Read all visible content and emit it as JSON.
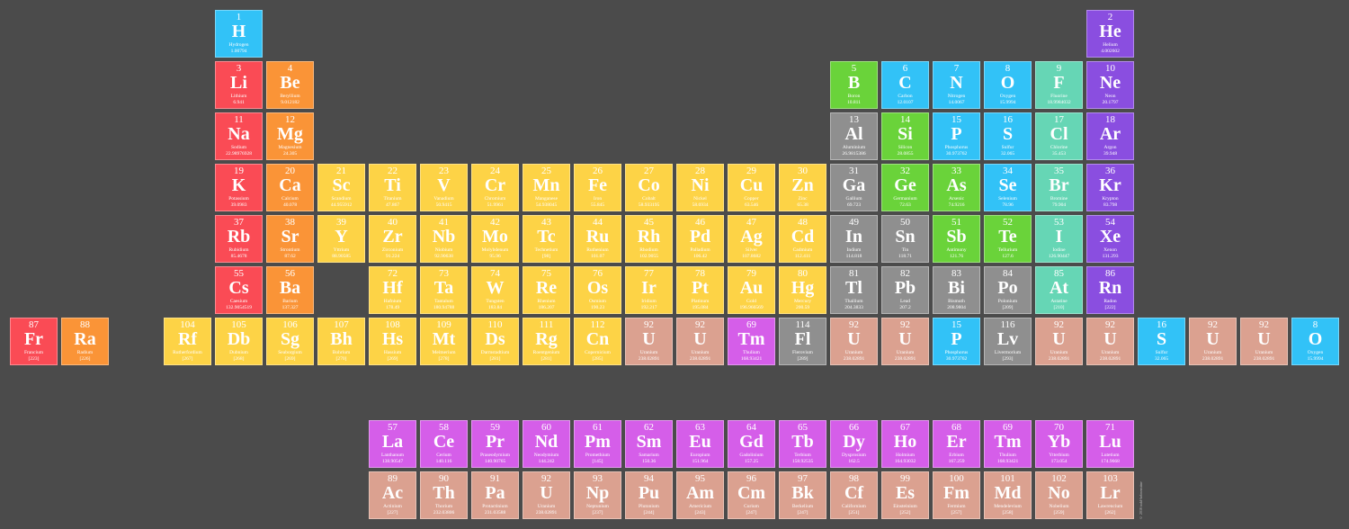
{
  "colors": {
    "alkali": "#fa4b55",
    "alkaline": "#fa9437",
    "transition": "#fdd346",
    "post": "#8f8f8f",
    "metalloid": "#6ad33a",
    "nonmetal": "#32c2f7",
    "halogen": "#66d6b5",
    "noble": "#8a4ee0",
    "lanthanide": "#d55ee9",
    "actinide": "#dba190"
  },
  "credit": "© 2016 todd-helmenstine",
  "elements": [
    {
      "n": "1",
      "s": "H",
      "name": "Hydrogen",
      "w": "1.00794",
      "c": "nonmetal",
      "col": 4,
      "row": 0
    },
    {
      "n": "2",
      "s": "He",
      "name": "Helium",
      "w": "4.002602",
      "c": "noble",
      "col": 21,
      "row": 0
    },
    {
      "n": "3",
      "s": "Li",
      "name": "Lithium",
      "w": "6.941",
      "c": "alkali",
      "col": 4,
      "row": 1
    },
    {
      "n": "4",
      "s": "Be",
      "name": "Beryllium",
      "w": "9.012182",
      "c": "alkaline",
      "col": 5,
      "row": 1
    },
    {
      "n": "5",
      "s": "B",
      "name": "Boron",
      "w": "10.811",
      "c": "metalloid",
      "col": 16,
      "row": 1
    },
    {
      "n": "6",
      "s": "C",
      "name": "Carbon",
      "w": "12.0107",
      "c": "nonmetal",
      "col": 17,
      "row": 1
    },
    {
      "n": "7",
      "s": "N",
      "name": "Nitrogen",
      "w": "14.0067",
      "c": "nonmetal",
      "col": 18,
      "row": 1
    },
    {
      "n": "8",
      "s": "O",
      "name": "Oxygen",
      "w": "15.9994",
      "c": "nonmetal",
      "col": 19,
      "row": 1
    },
    {
      "n": "9",
      "s": "F",
      "name": "Fluorine",
      "w": "18.9984032",
      "c": "halogen",
      "col": 20,
      "row": 1
    },
    {
      "n": "10",
      "s": "Ne",
      "name": "Neon",
      "w": "20.1797",
      "c": "noble",
      "col": 21,
      "row": 1
    },
    {
      "n": "11",
      "s": "Na",
      "name": "Sodium",
      "w": "22.98976928",
      "c": "alkali",
      "col": 4,
      "row": 2
    },
    {
      "n": "12",
      "s": "Mg",
      "name": "Magnesium",
      "w": "24.305",
      "c": "alkaline",
      "col": 5,
      "row": 2
    },
    {
      "n": "13",
      "s": "Al",
      "name": "Aluminium",
      "w": "26.9815386",
      "c": "post",
      "col": 16,
      "row": 2
    },
    {
      "n": "14",
      "s": "Si",
      "name": "Silicon",
      "w": "28.0855",
      "c": "metalloid",
      "col": 17,
      "row": 2
    },
    {
      "n": "15",
      "s": "P",
      "name": "Phosphorus",
      "w": "30.973762",
      "c": "nonmetal",
      "col": 18,
      "row": 2
    },
    {
      "n": "16",
      "s": "S",
      "name": "Sulfur",
      "w": "32.065",
      "c": "nonmetal",
      "col": 19,
      "row": 2
    },
    {
      "n": "17",
      "s": "Cl",
      "name": "Chlorine",
      "w": "35.453",
      "c": "halogen",
      "col": 20,
      "row": 2
    },
    {
      "n": "18",
      "s": "Ar",
      "name": "Argon",
      "w": "39.948",
      "c": "noble",
      "col": 21,
      "row": 2
    },
    {
      "n": "19",
      "s": "K",
      "name": "Potassium",
      "w": "39.0983",
      "c": "alkali",
      "col": 4,
      "row": 3
    },
    {
      "n": "20",
      "s": "Ca",
      "name": "Calcium",
      "w": "40.078",
      "c": "alkaline",
      "col": 5,
      "row": 3
    },
    {
      "n": "21",
      "s": "Sc",
      "name": "Scandium",
      "w": "44.955912",
      "c": "transition",
      "col": 6,
      "row": 3
    },
    {
      "n": "22",
      "s": "Ti",
      "name": "Titanium",
      "w": "47.867",
      "c": "transition",
      "col": 7,
      "row": 3
    },
    {
      "n": "23",
      "s": "V",
      "name": "Vanadium",
      "w": "50.9415",
      "c": "transition",
      "col": 8,
      "row": 3
    },
    {
      "n": "24",
      "s": "Cr",
      "name": "Chromium",
      "w": "51.9961",
      "c": "transition",
      "col": 9,
      "row": 3
    },
    {
      "n": "25",
      "s": "Mn",
      "name": "Manganese",
      "w": "54.938045",
      "c": "transition",
      "col": 10,
      "row": 3
    },
    {
      "n": "26",
      "s": "Fe",
      "name": "Iron",
      "w": "55.845",
      "c": "transition",
      "col": 11,
      "row": 3
    },
    {
      "n": "27",
      "s": "Co",
      "name": "Cobalt",
      "w": "58.933195",
      "c": "transition",
      "col": 12,
      "row": 3
    },
    {
      "n": "28",
      "s": "Ni",
      "name": "Nickel",
      "w": "58.6934",
      "c": "transition",
      "col": 13,
      "row": 3
    },
    {
      "n": "29",
      "s": "Cu",
      "name": "Copper",
      "w": "63.546",
      "c": "transition",
      "col": 14,
      "row": 3
    },
    {
      "n": "30",
      "s": "Zn",
      "name": "Zinc",
      "w": "65.38",
      "c": "transition",
      "col": 15,
      "row": 3
    },
    {
      "n": "31",
      "s": "Ga",
      "name": "Gallium",
      "w": "69.723",
      "c": "post",
      "col": 16,
      "row": 3
    },
    {
      "n": "32",
      "s": "Ge",
      "name": "Germanium",
      "w": "72.63",
      "c": "metalloid",
      "col": 17,
      "row": 3
    },
    {
      "n": "33",
      "s": "As",
      "name": "Arsenic",
      "w": "74.9216",
      "c": "metalloid",
      "col": 18,
      "row": 3
    },
    {
      "n": "34",
      "s": "Se",
      "name": "Selenium",
      "w": "78.96",
      "c": "nonmetal",
      "col": 19,
      "row": 3
    },
    {
      "n": "35",
      "s": "Br",
      "name": "Bromine",
      "w": "79.904",
      "c": "halogen",
      "col": 20,
      "row": 3
    },
    {
      "n": "36",
      "s": "Kr",
      "name": "Krypton",
      "w": "83.798",
      "c": "noble",
      "col": 21,
      "row": 3
    },
    {
      "n": "37",
      "s": "Rb",
      "name": "Rubidium",
      "w": "85.4678",
      "c": "alkali",
      "col": 4,
      "row": 4
    },
    {
      "n": "38",
      "s": "Sr",
      "name": "Strontium",
      "w": "87.62",
      "c": "alkaline",
      "col": 5,
      "row": 4
    },
    {
      "n": "39",
      "s": "Y",
      "name": "Yttrium",
      "w": "88.90585",
      "c": "transition",
      "col": 6,
      "row": 4
    },
    {
      "n": "40",
      "s": "Zr",
      "name": "Zirconium",
      "w": "91.224",
      "c": "transition",
      "col": 7,
      "row": 4
    },
    {
      "n": "41",
      "s": "Nb",
      "name": "Niobium",
      "w": "92.90638",
      "c": "transition",
      "col": 8,
      "row": 4
    },
    {
      "n": "42",
      "s": "Mo",
      "name": "Molybdenum",
      "w": "95.96",
      "c": "transition",
      "col": 9,
      "row": 4
    },
    {
      "n": "43",
      "s": "Tc",
      "name": "Technetium",
      "w": "[98]",
      "c": "transition",
      "col": 10,
      "row": 4
    },
    {
      "n": "44",
      "s": "Ru",
      "name": "Ruthenium",
      "w": "101.07",
      "c": "transition",
      "col": 11,
      "row": 4
    },
    {
      "n": "45",
      "s": "Rh",
      "name": "Rhodium",
      "w": "102.9055",
      "c": "transition",
      "col": 12,
      "row": 4
    },
    {
      "n": "46",
      "s": "Pd",
      "name": "Palladium",
      "w": "106.42",
      "c": "transition",
      "col": 13,
      "row": 4
    },
    {
      "n": "47",
      "s": "Ag",
      "name": "Silver",
      "w": "107.8682",
      "c": "transition",
      "col": 14,
      "row": 4
    },
    {
      "n": "48",
      "s": "Cd",
      "name": "Cadmium",
      "w": "112.411",
      "c": "transition",
      "col": 15,
      "row": 4
    },
    {
      "n": "49",
      "s": "In",
      "name": "Indium",
      "w": "114.818",
      "c": "post",
      "col": 16,
      "row": 4
    },
    {
      "n": "50",
      "s": "Sn",
      "name": "Tin",
      "w": "118.71",
      "c": "post",
      "col": 17,
      "row": 4
    },
    {
      "n": "51",
      "s": "Sb",
      "name": "Antimony",
      "w": "121.76",
      "c": "metalloid",
      "col": 18,
      "row": 4
    },
    {
      "n": "52",
      "s": "Te",
      "name": "Tellurium",
      "w": "127.6",
      "c": "metalloid",
      "col": 19,
      "row": 4
    },
    {
      "n": "53",
      "s": "I",
      "name": "Iodine",
      "w": "126.90447",
      "c": "halogen",
      "col": 20,
      "row": 4
    },
    {
      "n": "54",
      "s": "Xe",
      "name": "Xenon",
      "w": "131.293",
      "c": "noble",
      "col": 21,
      "row": 4
    },
    {
      "n": "55",
      "s": "Cs",
      "name": "Caesium",
      "w": "132.9054519",
      "c": "alkali",
      "col": 4,
      "row": 5
    },
    {
      "n": "56",
      "s": "Ba",
      "name": "Barium",
      "w": "137.327",
      "c": "alkaline",
      "col": 5,
      "row": 5
    },
    {
      "n": "72",
      "s": "Hf",
      "name": "Hafnium",
      "w": "178.49",
      "c": "transition",
      "col": 7,
      "row": 5
    },
    {
      "n": "73",
      "s": "Ta",
      "name": "Tantalum",
      "w": "180.94788",
      "c": "transition",
      "col": 8,
      "row": 5
    },
    {
      "n": "74",
      "s": "W",
      "name": "Tungsten",
      "w": "183.84",
      "c": "transition",
      "col": 9,
      "row": 5
    },
    {
      "n": "75",
      "s": "Re",
      "name": "Rhenium",
      "w": "186.207",
      "c": "transition",
      "col": 10,
      "row": 5
    },
    {
      "n": "76",
      "s": "Os",
      "name": "Osmium",
      "w": "190.23",
      "c": "transition",
      "col": 11,
      "row": 5
    },
    {
      "n": "77",
      "s": "Ir",
      "name": "Iridium",
      "w": "192.217",
      "c": "transition",
      "col": 12,
      "row": 5
    },
    {
      "n": "78",
      "s": "Pt",
      "name": "Platinum",
      "w": "195.084",
      "c": "transition",
      "col": 13,
      "row": 5
    },
    {
      "n": "79",
      "s": "Au",
      "name": "Gold",
      "w": "196.966569",
      "c": "transition",
      "col": 14,
      "row": 5
    },
    {
      "n": "80",
      "s": "Hg",
      "name": "Mercury",
      "w": "200.59",
      "c": "transition",
      "col": 15,
      "row": 5
    },
    {
      "n": "81",
      "s": "Tl",
      "name": "Thallium",
      "w": "204.3833",
      "c": "post",
      "col": 16,
      "row": 5
    },
    {
      "n": "82",
      "s": "Pb",
      "name": "Lead",
      "w": "207.2",
      "c": "post",
      "col": 17,
      "row": 5
    },
    {
      "n": "83",
      "s": "Bi",
      "name": "Bismuth",
      "w": "208.9804",
      "c": "post",
      "col": 18,
      "row": 5
    },
    {
      "n": "84",
      "s": "Po",
      "name": "Polonium",
      "w": "[209]",
      "c": "post",
      "col": 19,
      "row": 5
    },
    {
      "n": "85",
      "s": "At",
      "name": "Astatine",
      "w": "[210]",
      "c": "halogen",
      "col": 20,
      "row": 5
    },
    {
      "n": "86",
      "s": "Rn",
      "name": "Radon",
      "w": "[222]",
      "c": "noble",
      "col": 21,
      "row": 5
    },
    {
      "n": "87",
      "s": "Fr",
      "name": "Francium",
      "w": "[223]",
      "c": "alkali",
      "col": 0,
      "row": 6
    },
    {
      "n": "88",
      "s": "Ra",
      "name": "Radium",
      "w": "[226]",
      "c": "alkaline",
      "col": 1,
      "row": 6
    },
    {
      "n": "104",
      "s": "Rf",
      "name": "Rutherfordium",
      "w": "[267]",
      "c": "transition",
      "col": 3,
      "row": 6
    },
    {
      "n": "105",
      "s": "Db",
      "name": "Dubnium",
      "w": "[268]",
      "c": "transition",
      "col": 4,
      "row": 6
    },
    {
      "n": "106",
      "s": "Sg",
      "name": "Seaborgium",
      "w": "[269]",
      "c": "transition",
      "col": 5,
      "row": 6
    },
    {
      "n": "107",
      "s": "Bh",
      "name": "Bohrium",
      "w": "[270]",
      "c": "transition",
      "col": 6,
      "row": 6
    },
    {
      "n": "108",
      "s": "Hs",
      "name": "Hassium",
      "w": "[269]",
      "c": "transition",
      "col": 7,
      "row": 6
    },
    {
      "n": "109",
      "s": "Mt",
      "name": "Meitnerium",
      "w": "[278]",
      "c": "transition",
      "col": 8,
      "row": 6
    },
    {
      "n": "110",
      "s": "Ds",
      "name": "Darmstadtium",
      "w": "[281]",
      "c": "transition",
      "col": 9,
      "row": 6
    },
    {
      "n": "111",
      "s": "Rg",
      "name": "Roentgenium",
      "w": "[281]",
      "c": "transition",
      "col": 10,
      "row": 6
    },
    {
      "n": "112",
      "s": "Cn",
      "name": "Copernicium",
      "w": "[285]",
      "c": "transition",
      "col": 11,
      "row": 6
    },
    {
      "n": "92",
      "s": "U",
      "name": "Uranium",
      "w": "238.02891",
      "c": "actinide",
      "col": 12,
      "row": 6
    },
    {
      "n": "92",
      "s": "U",
      "name": "Uranium",
      "w": "238.02891",
      "c": "actinide",
      "col": 13,
      "row": 6
    },
    {
      "n": "69",
      "s": "Tm",
      "name": "Thulium",
      "w": "168.93421",
      "c": "lanthanide",
      "col": 14,
      "row": 6
    },
    {
      "n": "114",
      "s": "Fl",
      "name": "Flerovium",
      "w": "[289]",
      "c": "post",
      "col": 15,
      "row": 6
    },
    {
      "n": "92",
      "s": "U",
      "name": "Uranium",
      "w": "238.02891",
      "c": "actinide",
      "col": 16,
      "row": 6
    },
    {
      "n": "92",
      "s": "U",
      "name": "Uranium",
      "w": "238.02891",
      "c": "actinide",
      "col": 17,
      "row": 6
    },
    {
      "n": "15",
      "s": "P",
      "name": "Phosphorus",
      "w": "30.973762",
      "c": "nonmetal",
      "col": 18,
      "row": 6
    },
    {
      "n": "116",
      "s": "Lv",
      "name": "Livermorium",
      "w": "[293]",
      "c": "post",
      "col": 19,
      "row": 6
    },
    {
      "n": "92",
      "s": "U",
      "name": "Uranium",
      "w": "238.02891",
      "c": "actinide",
      "col": 20,
      "row": 6
    },
    {
      "n": "92",
      "s": "U",
      "name": "Uranium",
      "w": "238.02891",
      "c": "actinide",
      "col": 21,
      "row": 6
    },
    {
      "n": "16",
      "s": "S",
      "name": "Sulfur",
      "w": "32.065",
      "c": "nonmetal",
      "col": 22,
      "row": 6
    },
    {
      "n": "92",
      "s": "U",
      "name": "Uranium",
      "w": "238.02891",
      "c": "actinide",
      "col": 23,
      "row": 6
    },
    {
      "n": "92",
      "s": "U",
      "name": "Uranium",
      "w": "238.02891",
      "c": "actinide",
      "col": 24,
      "row": 6
    },
    {
      "n": "8",
      "s": "O",
      "name": "Oxygen",
      "w": "15.9994",
      "c": "nonmetal",
      "col": 25,
      "row": 6
    },
    {
      "n": "57",
      "s": "La",
      "name": "Lanthanum",
      "w": "138.90547",
      "c": "lanthanide",
      "col": 7,
      "row": 8
    },
    {
      "n": "58",
      "s": "Ce",
      "name": "Cerium",
      "w": "140.116",
      "c": "lanthanide",
      "col": 8,
      "row": 8
    },
    {
      "n": "59",
      "s": "Pr",
      "name": "Praseodymium",
      "w": "140.90765",
      "c": "lanthanide",
      "col": 9,
      "row": 8
    },
    {
      "n": "60",
      "s": "Nd",
      "name": "Neodymium",
      "w": "144.242",
      "c": "lanthanide",
      "col": 10,
      "row": 8
    },
    {
      "n": "61",
      "s": "Pm",
      "name": "Promethium",
      "w": "[145]",
      "c": "lanthanide",
      "col": 11,
      "row": 8
    },
    {
      "n": "62",
      "s": "Sm",
      "name": "Samarium",
      "w": "150.36",
      "c": "lanthanide",
      "col": 12,
      "row": 8
    },
    {
      "n": "63",
      "s": "Eu",
      "name": "Europium",
      "w": "151.964",
      "c": "lanthanide",
      "col": 13,
      "row": 8
    },
    {
      "n": "64",
      "s": "Gd",
      "name": "Gadolinium",
      "w": "157.25",
      "c": "lanthanide",
      "col": 14,
      "row": 8
    },
    {
      "n": "65",
      "s": "Tb",
      "name": "Terbium",
      "w": "158.92535",
      "c": "lanthanide",
      "col": 15,
      "row": 8
    },
    {
      "n": "66",
      "s": "Dy",
      "name": "Dysprosium",
      "w": "162.5",
      "c": "lanthanide",
      "col": 16,
      "row": 8
    },
    {
      "n": "67",
      "s": "Ho",
      "name": "Holmium",
      "w": "164.93032",
      "c": "lanthanide",
      "col": 17,
      "row": 8
    },
    {
      "n": "68",
      "s": "Er",
      "name": "Erbium",
      "w": "167.259",
      "c": "lanthanide",
      "col": 18,
      "row": 8
    },
    {
      "n": "69",
      "s": "Tm",
      "name": "Thulium",
      "w": "168.93421",
      "c": "lanthanide",
      "col": 19,
      "row": 8
    },
    {
      "n": "70",
      "s": "Yb",
      "name": "Ytterbium",
      "w": "173.054",
      "c": "lanthanide",
      "col": 20,
      "row": 8
    },
    {
      "n": "71",
      "s": "Lu",
      "name": "Lutetium",
      "w": "174.9668",
      "c": "lanthanide",
      "col": 21,
      "row": 8
    },
    {
      "n": "89",
      "s": "Ac",
      "name": "Actinium",
      "w": "[227]",
      "c": "actinide",
      "col": 7,
      "row": 9
    },
    {
      "n": "90",
      "s": "Th",
      "name": "Thorium",
      "w": "232.03806",
      "c": "actinide",
      "col": 8,
      "row": 9
    },
    {
      "n": "91",
      "s": "Pa",
      "name": "Protactinium",
      "w": "231.03588",
      "c": "actinide",
      "col": 9,
      "row": 9
    },
    {
      "n": "92",
      "s": "U",
      "name": "Uranium",
      "w": "238.02891",
      "c": "actinide",
      "col": 10,
      "row": 9
    },
    {
      "n": "93",
      "s": "Np",
      "name": "Neptunium",
      "w": "[237]",
      "c": "actinide",
      "col": 11,
      "row": 9
    },
    {
      "n": "94",
      "s": "Pu",
      "name": "Plutonium",
      "w": "[244]",
      "c": "actinide",
      "col": 12,
      "row": 9
    },
    {
      "n": "95",
      "s": "Am",
      "name": "Americium",
      "w": "[243]",
      "c": "actinide",
      "col": 13,
      "row": 9
    },
    {
      "n": "96",
      "s": "Cm",
      "name": "Curium",
      "w": "[247]",
      "c": "actinide",
      "col": 14,
      "row": 9
    },
    {
      "n": "97",
      "s": "Bk",
      "name": "Berkelium",
      "w": "[247]",
      "c": "actinide",
      "col": 15,
      "row": 9
    },
    {
      "n": "98",
      "s": "Cf",
      "name": "Californium",
      "w": "[251]",
      "c": "actinide",
      "col": 16,
      "row": 9
    },
    {
      "n": "99",
      "s": "Es",
      "name": "Einsteinium",
      "w": "[252]",
      "c": "actinide",
      "col": 17,
      "row": 9
    },
    {
      "n": "100",
      "s": "Fm",
      "name": "Fermium",
      "w": "[257]",
      "c": "actinide",
      "col": 18,
      "row": 9
    },
    {
      "n": "101",
      "s": "Md",
      "name": "Mendelevium",
      "w": "[258]",
      "c": "actinide",
      "col": 19,
      "row": 9
    },
    {
      "n": "102",
      "s": "No",
      "name": "Nobelium",
      "w": "[259]",
      "c": "actinide",
      "col": 20,
      "row": 9
    },
    {
      "n": "103",
      "s": "Lr",
      "name": "Lawrencium",
      "w": "[262]",
      "c": "actinide",
      "col": 21,
      "row": 9
    }
  ]
}
